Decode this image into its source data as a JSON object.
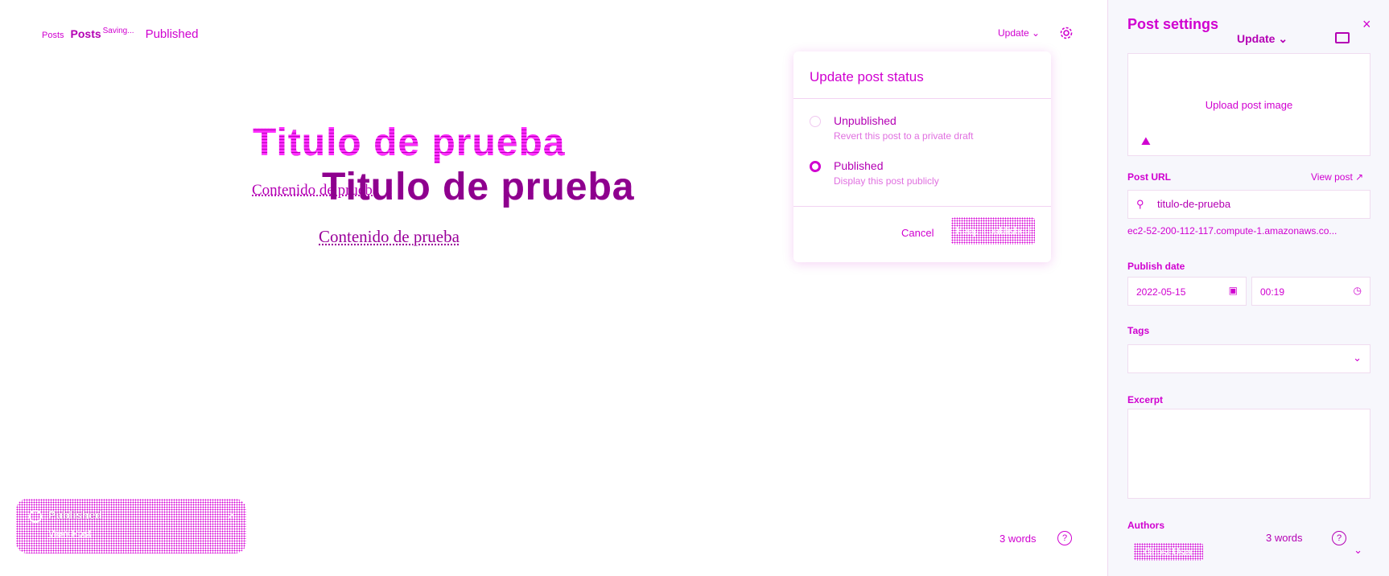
{
  "header": {
    "crumb_parent": "Posts",
    "crumb_current": "Posts",
    "saving": "Saving...",
    "status": "Published",
    "update_label": "Update ⌄"
  },
  "editor": {
    "title": "Titulo de prueba",
    "content": "Contenido de prueba"
  },
  "popover": {
    "title": "Update post status",
    "options": [
      {
        "label": "Unpublished",
        "desc": "Revert this post to a private draft"
      },
      {
        "label": "Published",
        "desc": "Display this post publicly"
      }
    ],
    "selected": "Published",
    "cancel": "Cancel",
    "confirm": "Keep it published"
  },
  "toast": {
    "text": "Published",
    "link": "View Post",
    "close": "×"
  },
  "footer": {
    "words": "3 words",
    "help": "?"
  },
  "sidebar": {
    "title": "Post settings",
    "update_label": "Update ⌄",
    "close": "×",
    "upload_label": "Upload post image",
    "post_url_label": "Post URL",
    "view_post": "View post ↗",
    "slug": "titulo-de-prueba",
    "full_url": "ec2-52-200-112-117.compute-1.amazonaws.co...",
    "publish_date_label": "Publish date",
    "date": "2022-05-15",
    "time": "00:19",
    "tags_label": "Tags",
    "excerpt_label": "Excerpt",
    "authors_label": "Authors",
    "author": "Ghost User",
    "words": "3 words"
  },
  "colors": {
    "accent": "#d000d0",
    "accent_dark": "#b400b4"
  }
}
